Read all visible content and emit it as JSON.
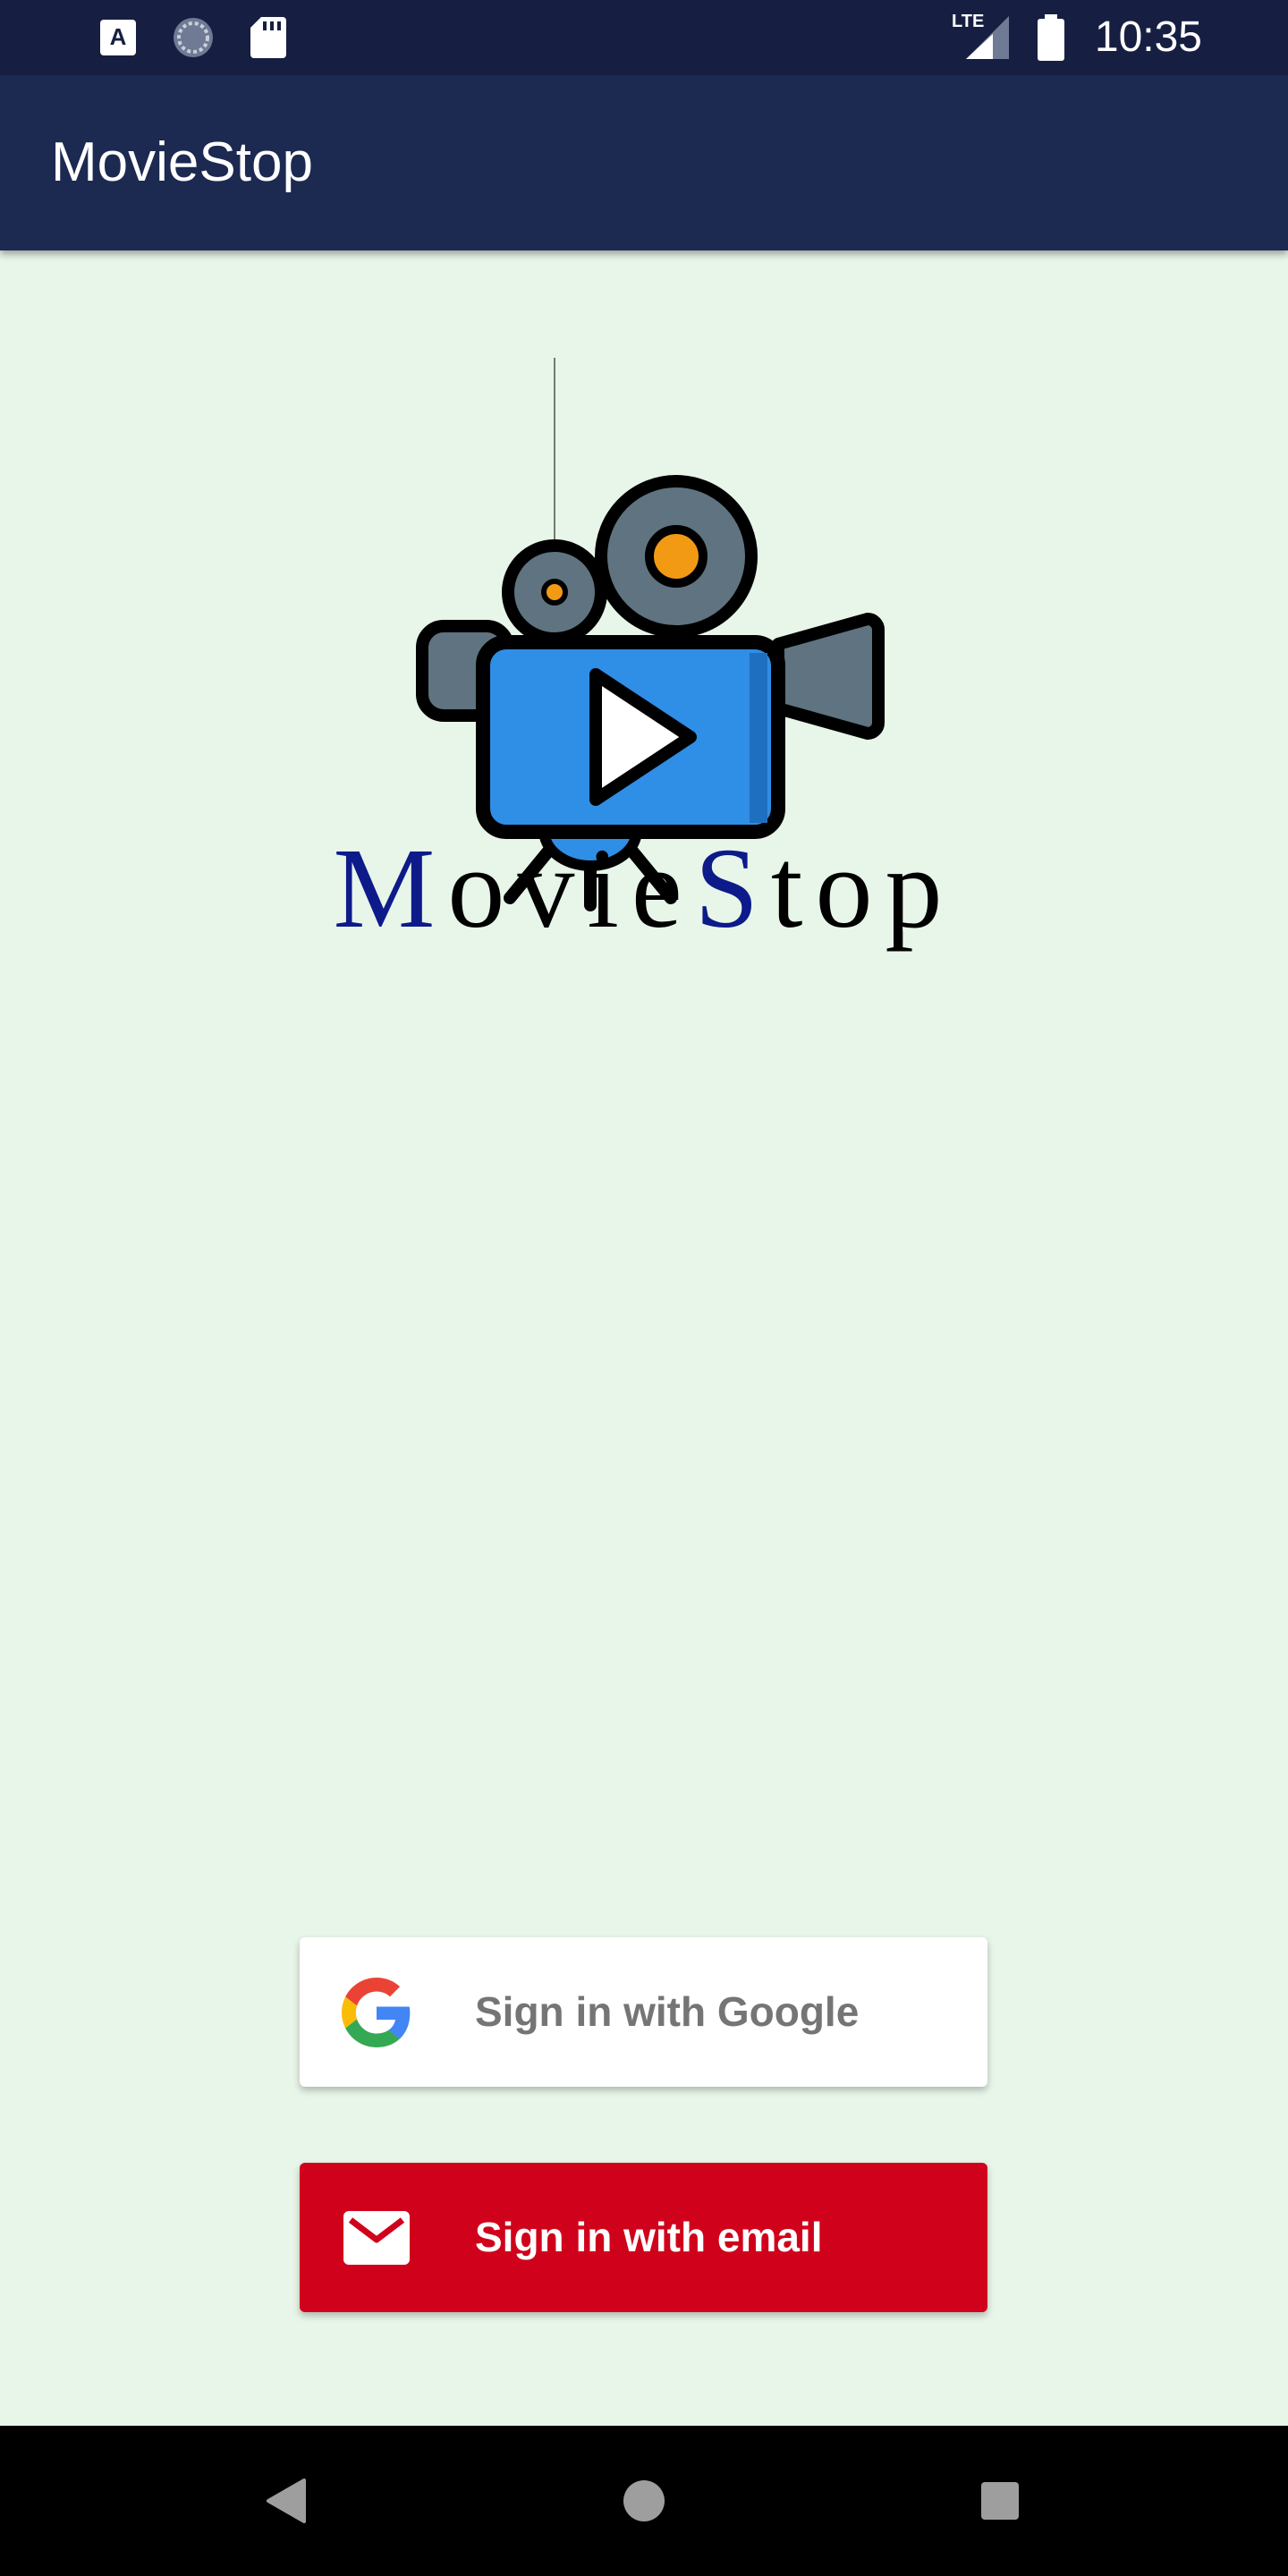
{
  "status_bar": {
    "time": "10:35",
    "icons": [
      "font-icon",
      "sync-icon",
      "sd-card-icon",
      "lte-signal-icon",
      "battery-icon"
    ],
    "network_label": "LTE"
  },
  "app_bar": {
    "title": "MovieStop"
  },
  "logo": {
    "wordmark_parts": [
      "M",
      "ovie",
      "S",
      "top"
    ],
    "colors": {
      "camera_body": "#2f8ee6",
      "camera_gray": "#5f7380",
      "reel_center": "#f39a14",
      "wordmark_caps": "#0d1a8a"
    }
  },
  "buttons": {
    "google": {
      "label": "Sign in with Google",
      "icon": "google-icon",
      "background": "#ffffff",
      "text_color": "#757575"
    },
    "email": {
      "label": "Sign in with email",
      "icon": "mail-icon",
      "background": "#d0021b",
      "text_color": "#ffffff"
    }
  },
  "nav_bar": {
    "items": [
      "back-icon",
      "home-icon",
      "recents-icon"
    ]
  },
  "colors": {
    "status_bar": "#161f42",
    "app_bar": "#1c2951",
    "background": "#e8f5e9",
    "nav_bar": "#000000"
  }
}
